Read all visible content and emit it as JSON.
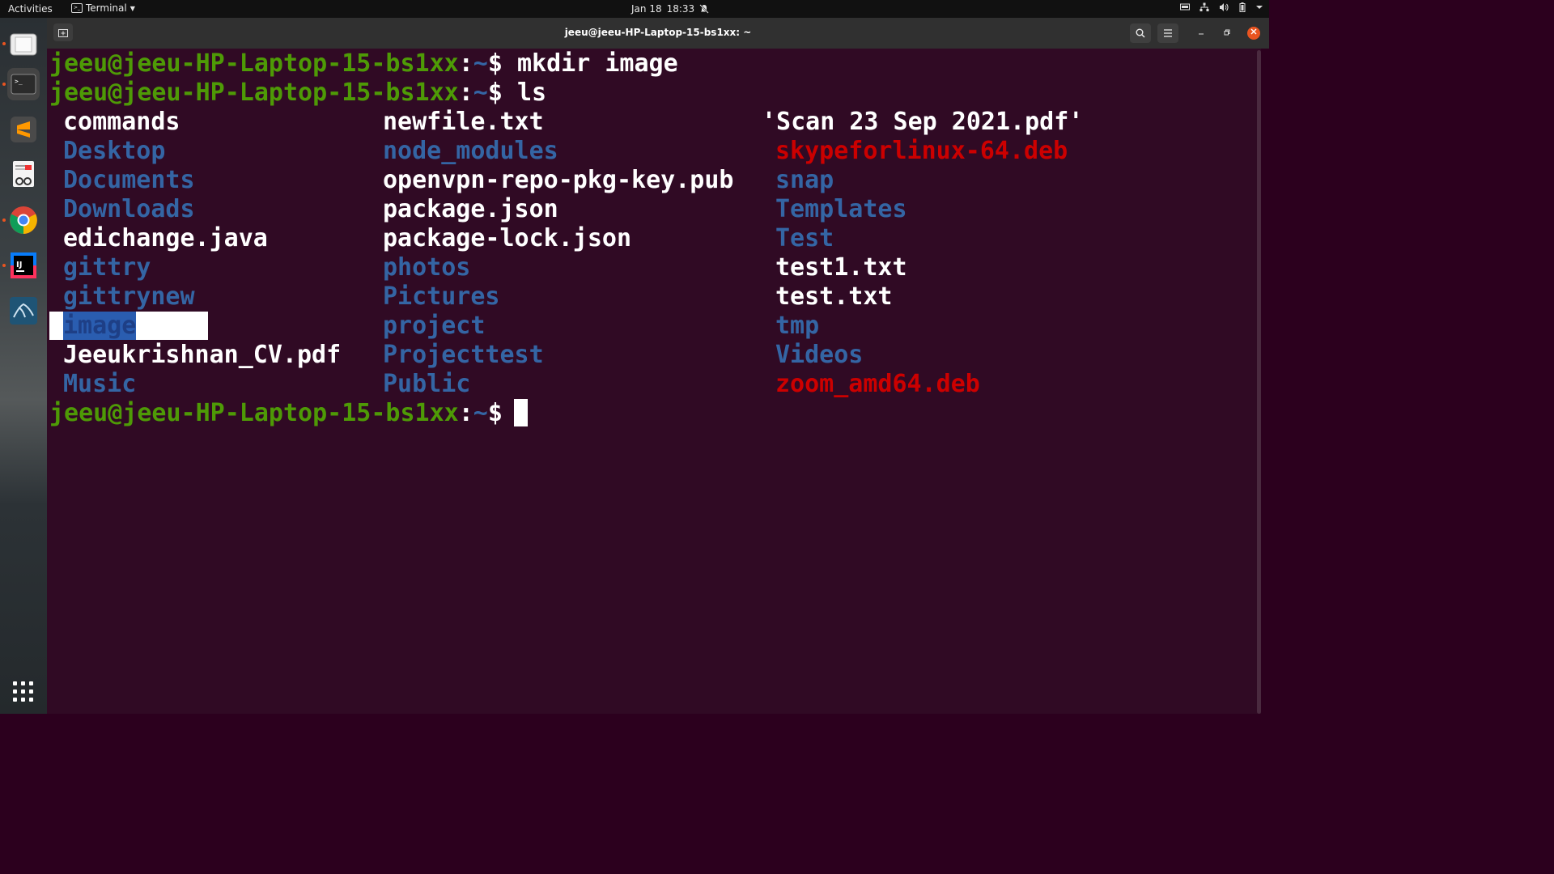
{
  "topbar": {
    "activities": "Activities",
    "app_name": "Terminal",
    "date": "Jan 18",
    "time": "18:33"
  },
  "window": {
    "title": "jeeu@jeeu-HP-Laptop-15-bs1xx: ~"
  },
  "dock": {
    "items": [
      "files-icon",
      "terminal-icon",
      "sublime-text-icon",
      "document-viewer-icon",
      "chrome-icon",
      "intellij-icon",
      "mysql-workbench-icon"
    ],
    "show_apps": "show-applications-icon"
  },
  "terminal": {
    "prompt_user": "jeeu@jeeu-HP-Laptop-15-bs1xx",
    "prompt_colon": ":",
    "prompt_path": "~",
    "prompt_symbol": "$",
    "commands": [
      "mkdir image",
      "ls"
    ],
    "ls_columns": [
      [
        {
          "name": "commands",
          "color": "white"
        },
        {
          "name": "Desktop",
          "color": "blue"
        },
        {
          "name": "Documents",
          "color": "blue"
        },
        {
          "name": "Downloads",
          "color": "blue"
        },
        {
          "name": "edichange.java",
          "color": "white"
        },
        {
          "name": "gittry",
          "color": "blue"
        },
        {
          "name": "gittrynew",
          "color": "blue"
        },
        {
          "name": "image",
          "color": "blue",
          "selected": true
        },
        {
          "name": "Jeeukrishnan_CV.pdf",
          "color": "white"
        },
        {
          "name": "Music",
          "color": "blue"
        }
      ],
      [
        {
          "name": "newfile.txt",
          "color": "white"
        },
        {
          "name": "node_modules",
          "color": "blue"
        },
        {
          "name": "openvpn-repo-pkg-key.pub",
          "color": "white"
        },
        {
          "name": "package.json",
          "color": "white"
        },
        {
          "name": "package-lock.json",
          "color": "white"
        },
        {
          "name": "photos",
          "color": "blue"
        },
        {
          "name": "Pictures",
          "color": "blue"
        },
        {
          "name": "project",
          "color": "blue"
        },
        {
          "name": "Projecttest",
          "color": "blue"
        },
        {
          "name": "Public",
          "color": "blue"
        }
      ],
      [
        {
          "name": "'Scan 23 Sep 2021.pdf'",
          "color": "white"
        },
        {
          "name": "skypeforlinux-64.deb",
          "color": "red"
        },
        {
          "name": "snap",
          "color": "blue"
        },
        {
          "name": "Templates",
          "color": "blue"
        },
        {
          "name": "Test",
          "color": "blue"
        },
        {
          "name": "test1.txt",
          "color": "white"
        },
        {
          "name": "test.txt",
          "color": "white"
        },
        {
          "name": "tmp",
          "color": "blue"
        },
        {
          "name": "Videos",
          "color": "blue"
        },
        {
          "name": "zoom_amd64.deb",
          "color": "red"
        }
      ]
    ],
    "colors": {
      "background": "#300a24",
      "prompt": "#4e9a06",
      "dir": "#3465a4",
      "archive": "#cc0000",
      "text": "#ffffff"
    }
  }
}
